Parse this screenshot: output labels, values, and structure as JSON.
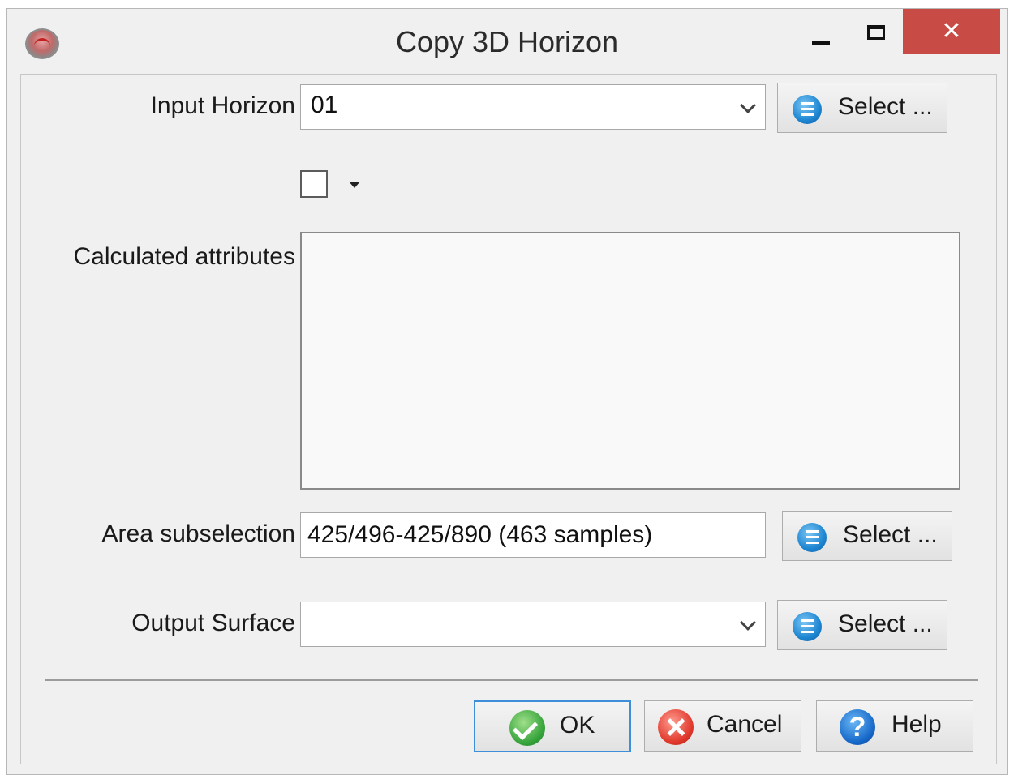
{
  "window": {
    "title": "Copy 3D Horizon",
    "close_glyph": "✕"
  },
  "form": {
    "input_horizon": {
      "label": "Input Horizon",
      "value": "01",
      "select_label": "Select ..."
    },
    "calculated_attributes": {
      "label": "Calculated attributes",
      "checked": false
    },
    "area_subselection": {
      "label": "Area subselection",
      "value": "425/496-425/890 (463 samples)",
      "select_label": "Select ..."
    },
    "output_surface": {
      "label": "Output Surface",
      "value": "",
      "select_label": "Select ..."
    }
  },
  "buttons": {
    "ok": "OK",
    "cancel": "Cancel",
    "help": "Help",
    "help_glyph": "?"
  },
  "colors": {
    "close_button": "#c94b45",
    "dialog_bg": "#f0f0f0",
    "ok_focus_border": "#3c8fd8"
  }
}
